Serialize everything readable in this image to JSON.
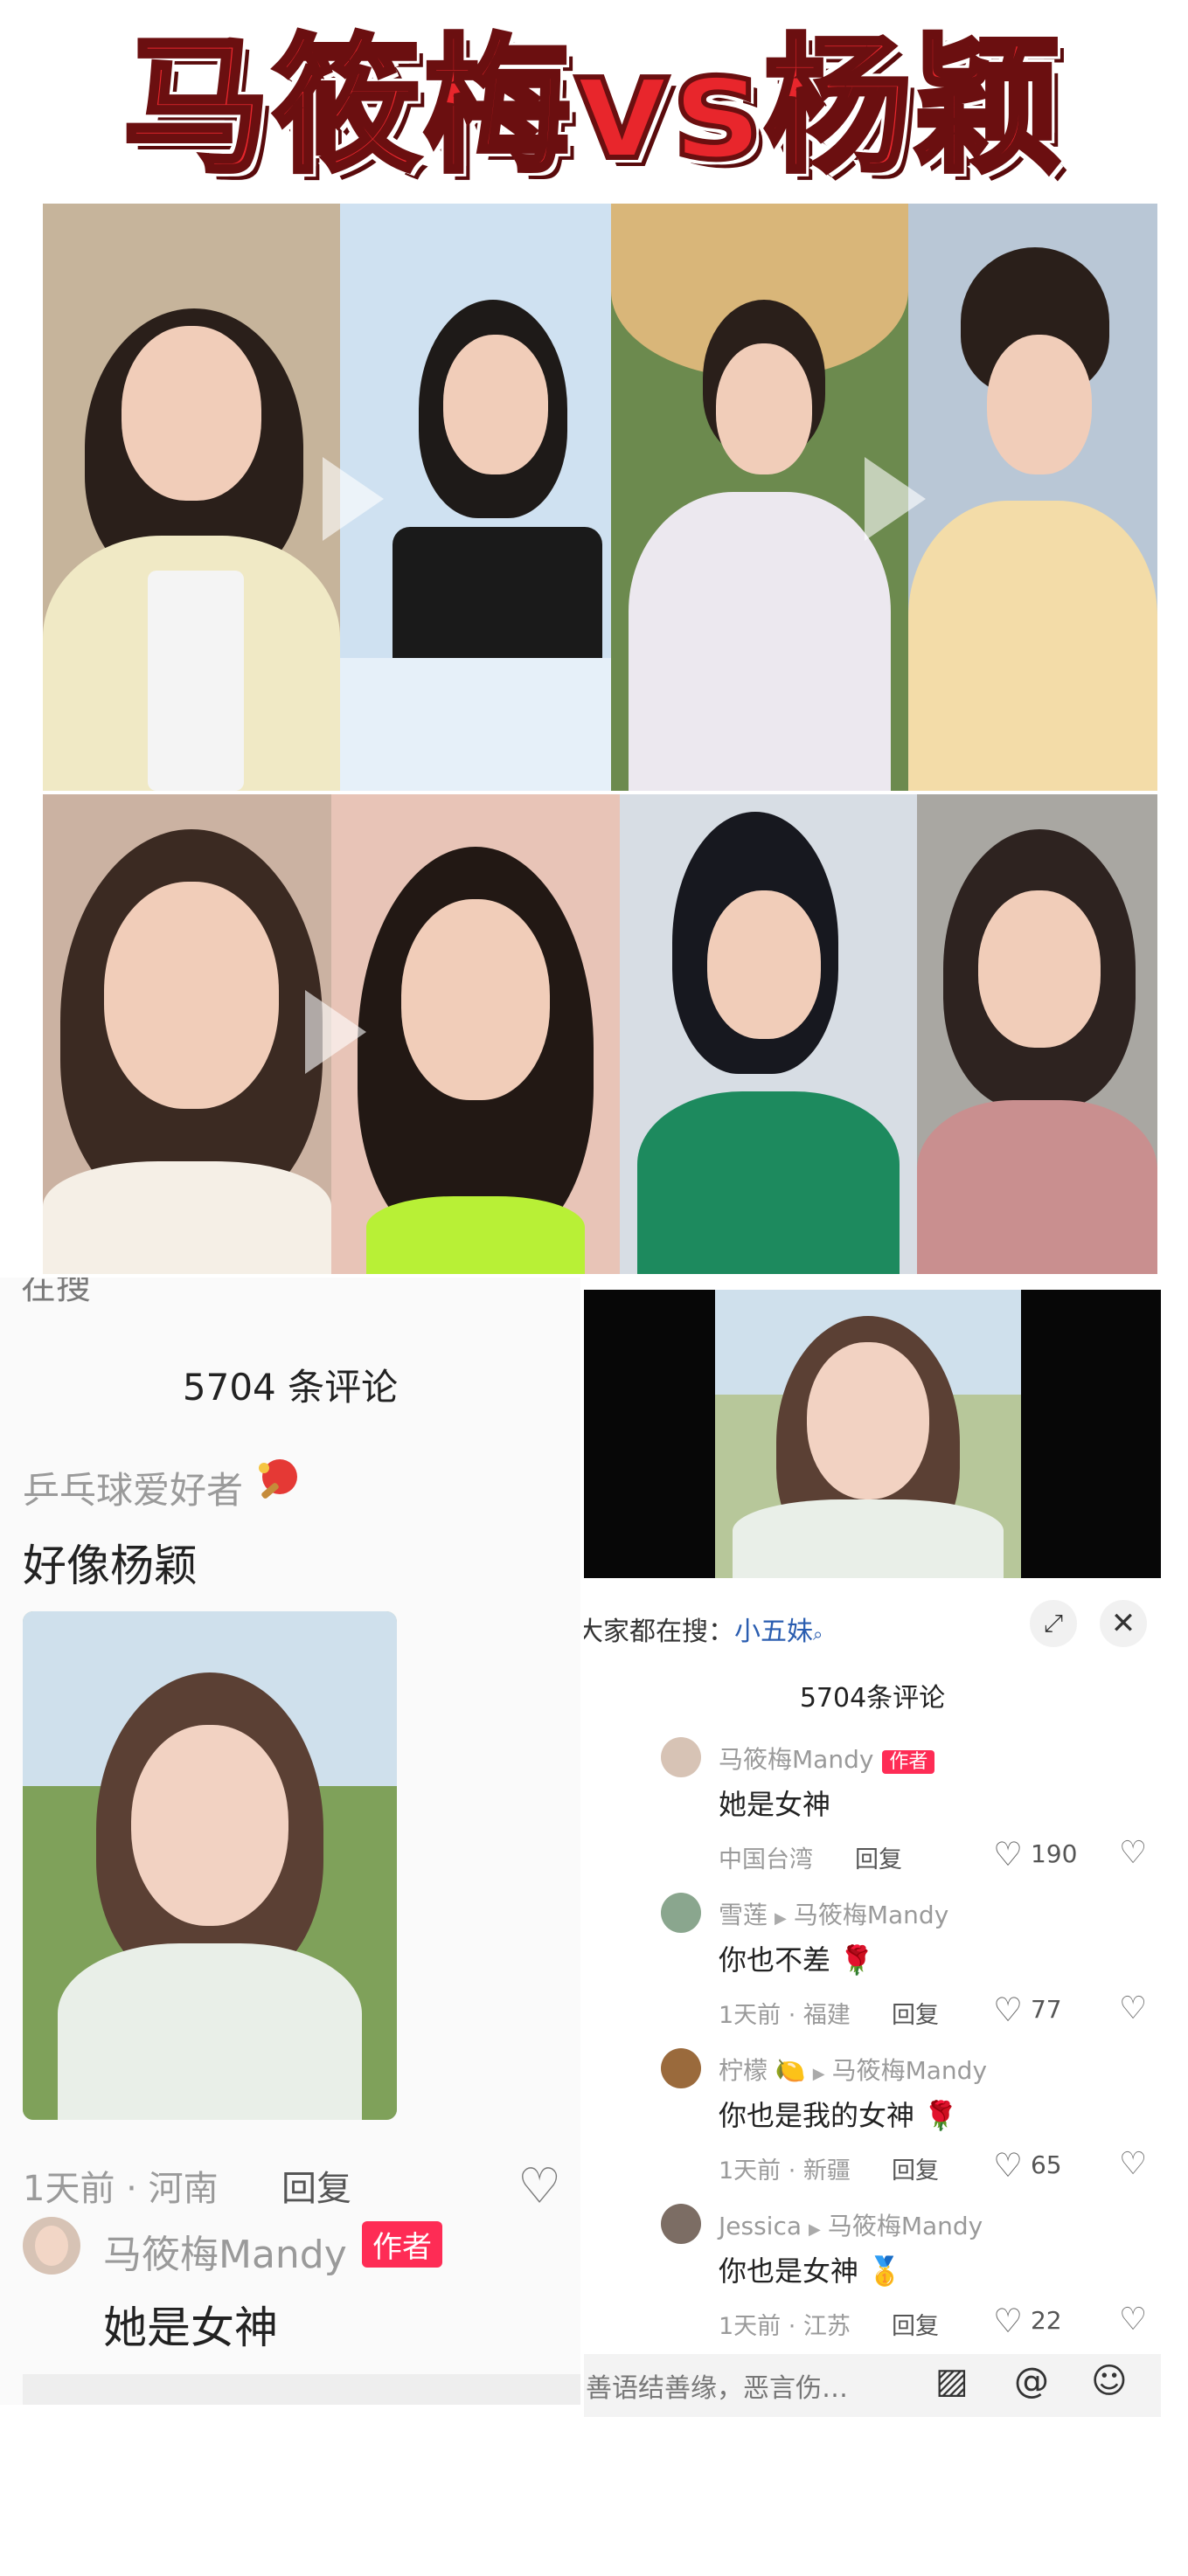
{
  "title": "马筱梅vs杨颖",
  "left_panel": {
    "search_cut": "在搜",
    "comment_count": "5704 条评论",
    "comment1": {
      "user": "乒乓球爱好者",
      "text": "好像杨颖",
      "meta": "1天前 · 河南",
      "reply": "回复"
    },
    "author_comment": {
      "name": "马筱梅Mandy",
      "badge": "作者",
      "text": "她是女神"
    }
  },
  "right_panel": {
    "search_label": "大家都在搜：",
    "search_keyword": "小五妹",
    "search_icon": "search-icon",
    "expand_icon": "expand-icon",
    "close_icon": "close-icon",
    "comment_count": "5704条评论",
    "comments": [
      {
        "name": "马筱梅Mandy",
        "badge": "作者",
        "reply_to": "",
        "text": "她是女神",
        "meta": "中国台湾",
        "reply": "回复",
        "likes": "190"
      },
      {
        "name": "雪莲",
        "badge": "",
        "reply_to": "马筱梅Mandy",
        "text": "你也不差 🌹",
        "meta": "1天前 · 福建",
        "reply": "回复",
        "likes": "77"
      },
      {
        "name": "柠檬 🍋",
        "badge": "",
        "reply_to": "马筱梅Mandy",
        "text": "你也是我的女神 🌹",
        "meta": "1天前 · 新疆",
        "reply": "回复",
        "likes": "65"
      },
      {
        "name": "Jessica",
        "badge": "",
        "reply_to": "马筱梅Mandy",
        "text": "你也是女神 🥇",
        "meta": "1天前 · 江苏",
        "reply": "回复",
        "likes": "22"
      }
    ],
    "input_placeholder": "善语结善缘，恶言伤…",
    "input_icons": [
      "image-icon",
      "at-icon",
      "emoji-icon"
    ]
  },
  "colors": {
    "title_red": "#e8262c",
    "badge_red": "#fe2c55",
    "keyword_blue": "#2a5db0"
  }
}
